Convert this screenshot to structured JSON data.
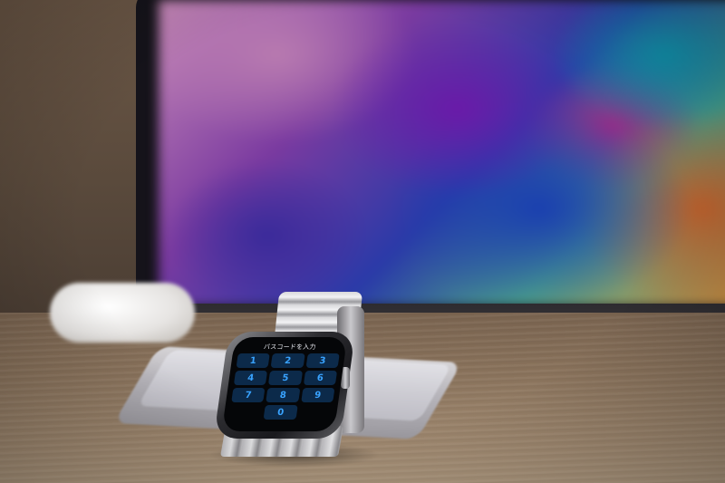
{
  "scene": {
    "subject": "apple-watch-on-desk",
    "objects": [
      "laptop",
      "airpods-case",
      "smartphone",
      "smartwatch",
      "wooden-desk"
    ]
  },
  "watch": {
    "screen_title": "パスコードを入力",
    "keys": [
      "1",
      "2",
      "3",
      "4",
      "5",
      "6",
      "7",
      "8",
      "9",
      "",
      "0",
      ""
    ]
  },
  "colors": {
    "key_text": "#39a3ff",
    "key_bg": "#0c2a4a",
    "desk": "#a08970"
  }
}
